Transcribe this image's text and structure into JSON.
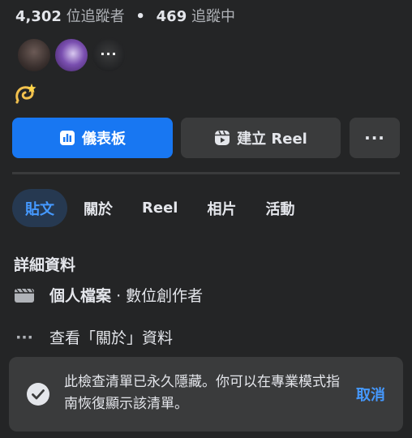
{
  "header": {
    "followers_count": "4,302",
    "followers_label": "位追蹤者",
    "separator": "•",
    "following_count": "469",
    "following_label": "追蹤中"
  },
  "avatars": [
    {
      "icon": "avatar-photo"
    },
    {
      "icon": "avatar-photo"
    },
    {
      "icon": "more-dots-icon",
      "label": "···"
    }
  ],
  "status_emoji": {
    "icon": "dizzy-emoji"
  },
  "actions": {
    "dashboard_label": "儀表板",
    "create_reel_label": "建立 Reel",
    "more_label": "···"
  },
  "tabs": [
    {
      "label": "貼文",
      "active": true
    },
    {
      "label": "關於",
      "active": false
    },
    {
      "label": "Reel",
      "active": false
    },
    {
      "label": "相片",
      "active": false
    },
    {
      "label": "活動",
      "active": false
    }
  ],
  "details": {
    "title": "詳細資料",
    "profile_type_strong": "個人檔案",
    "profile_type_rest": "· 數位創作者",
    "more_icon": "···",
    "about_link": "查看「關於」資料"
  },
  "toast": {
    "message": "此檢查清單已永久隱藏。你可以在專業模式指南恢復顯示該清單。",
    "cancel_label": "取消"
  },
  "colors": {
    "background": "#242526",
    "surface": "#3a3b3c",
    "primary": "#1877f2",
    "link": "#4599ff",
    "text": "#e4e6eb",
    "muted": "#b0b3b8"
  }
}
